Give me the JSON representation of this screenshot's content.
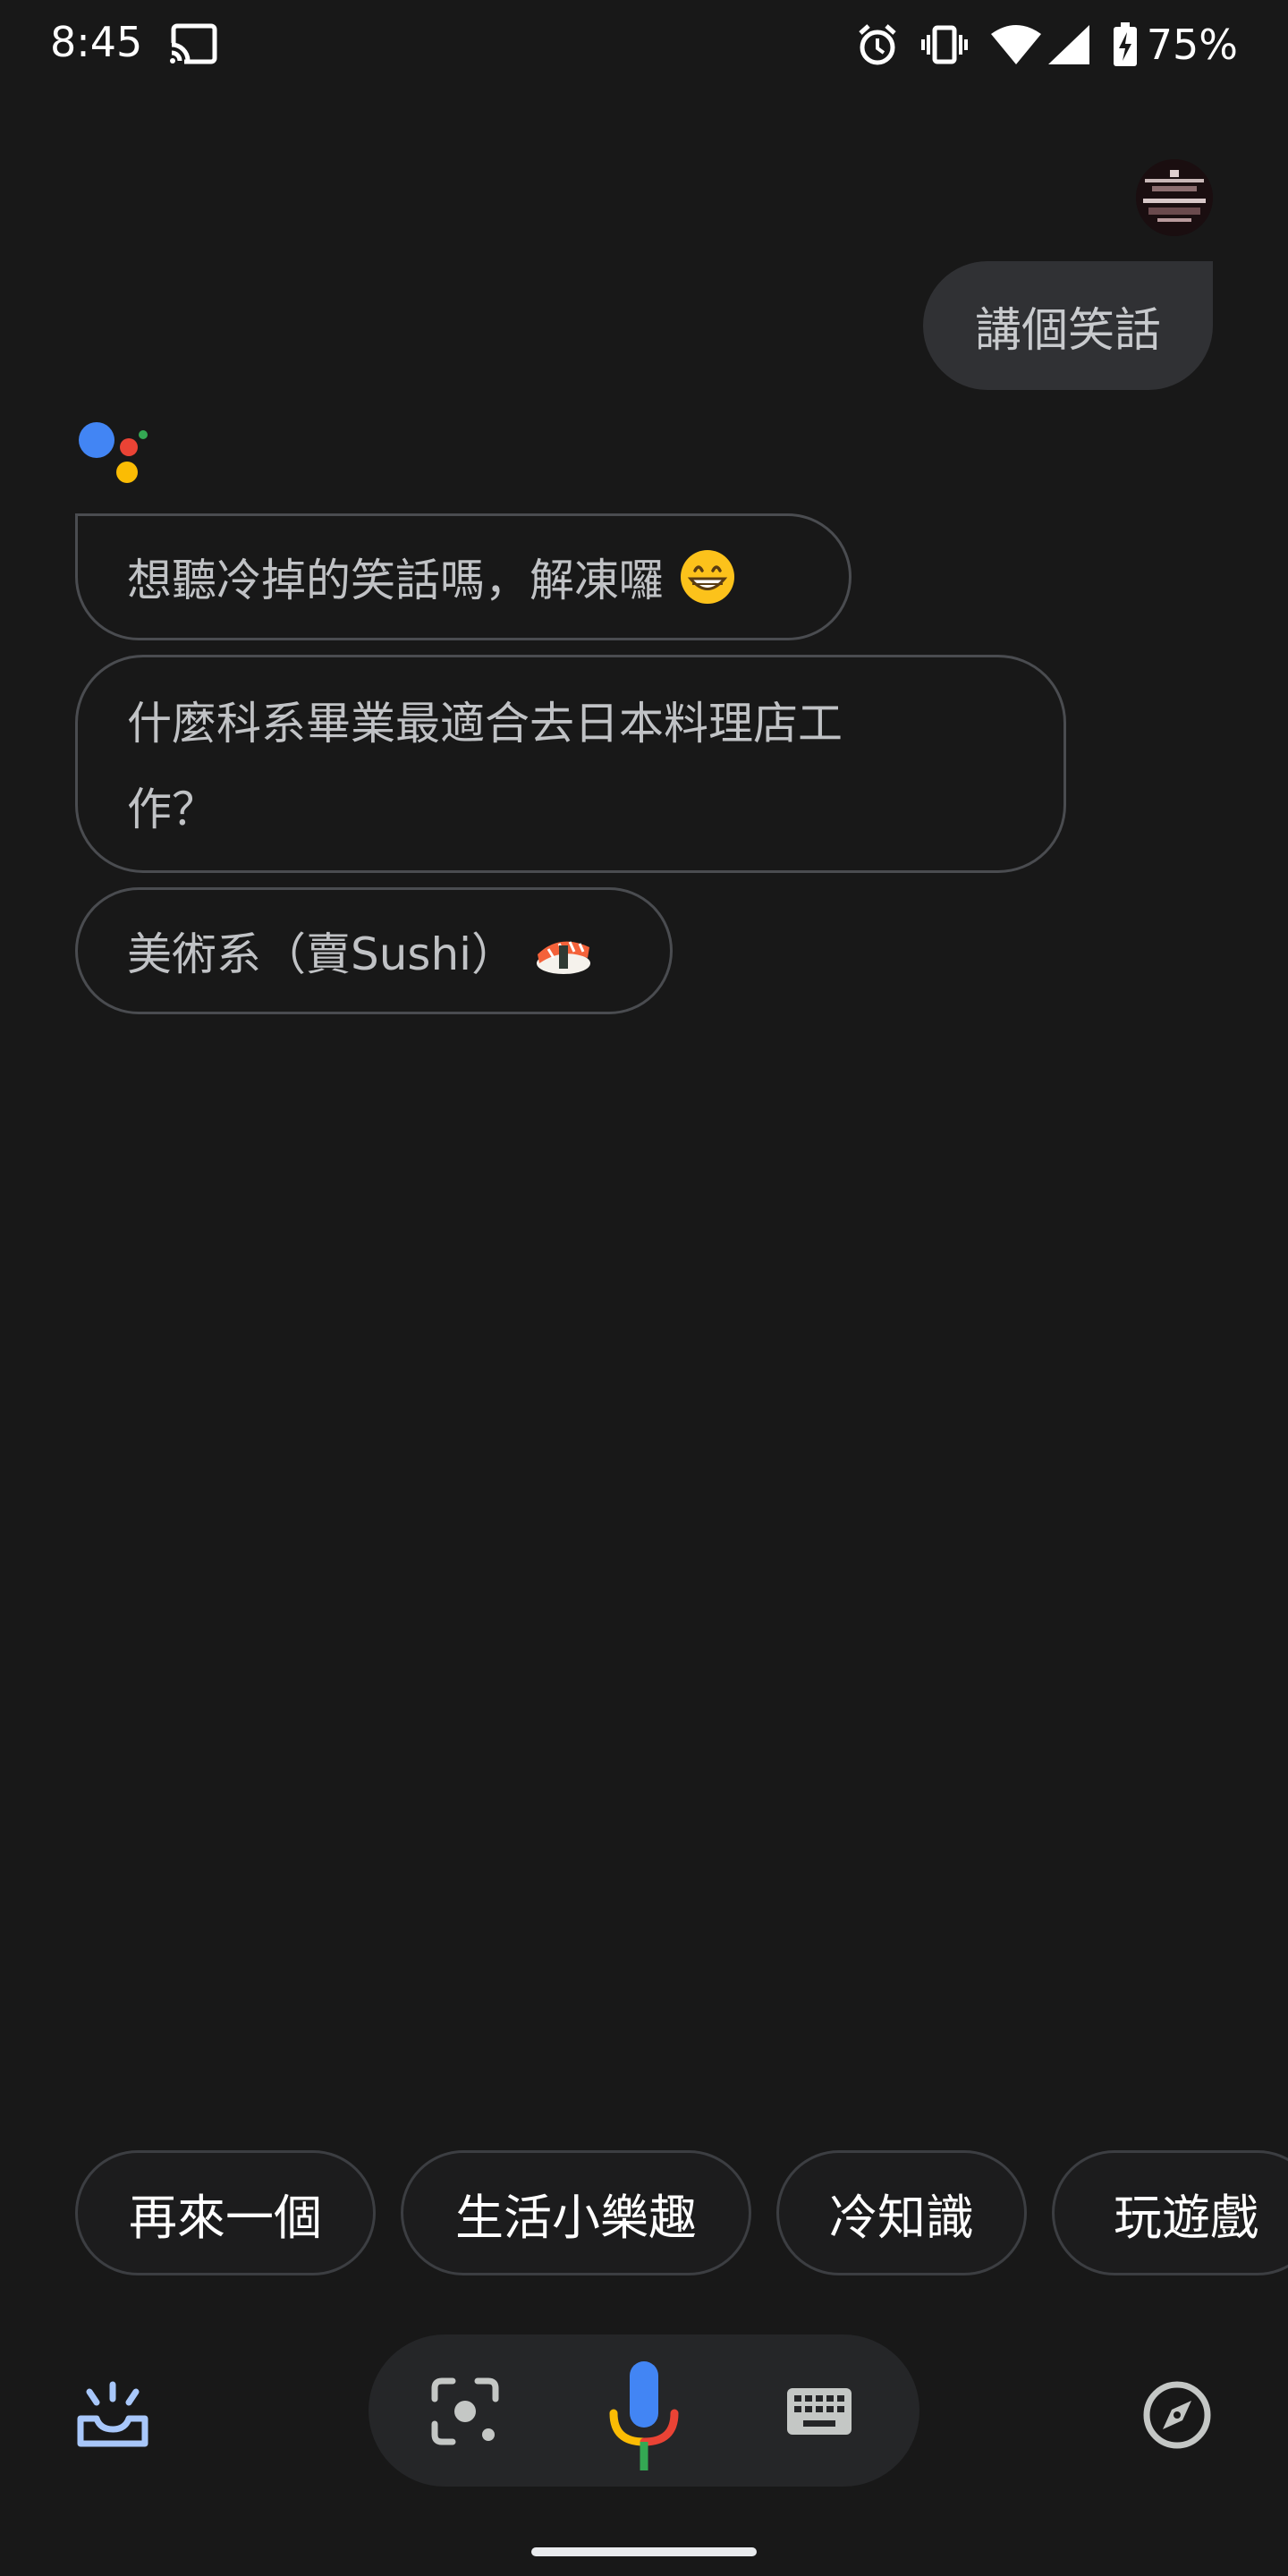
{
  "status_bar": {
    "time": "8:45",
    "battery_percent": "75%",
    "icons": [
      "cast-icon",
      "alarm-icon",
      "vibrate-icon",
      "wifi-icon",
      "signal-icon",
      "battery-charging-icon"
    ]
  },
  "conversation": {
    "user_message": "講個笑話",
    "assistant_messages": [
      {
        "text": "想聽冷掉的笑話嗎，解凍囉",
        "emoji": "grinning-face-icon"
      },
      {
        "line1": "什麼科系畢業最適合去日本料理店工",
        "line2": "作？"
      },
      {
        "text": "美術系（賣Sushi）",
        "emoji": "sushi-icon"
      }
    ]
  },
  "suggestions": [
    "再來一個",
    "生活小樂趣",
    "冷知識",
    "玩遊戲"
  ],
  "bottom_bar": {
    "icons": [
      "updates-icon",
      "lens-icon",
      "mic-icon",
      "keyboard-icon",
      "explore-icon"
    ]
  },
  "colors": {
    "background": "#181818",
    "user_bubble": "#303134",
    "google_blue": "#4285F4",
    "google_red": "#EA4335",
    "google_yellow": "#FBBC04",
    "google_green": "#34A853"
  }
}
